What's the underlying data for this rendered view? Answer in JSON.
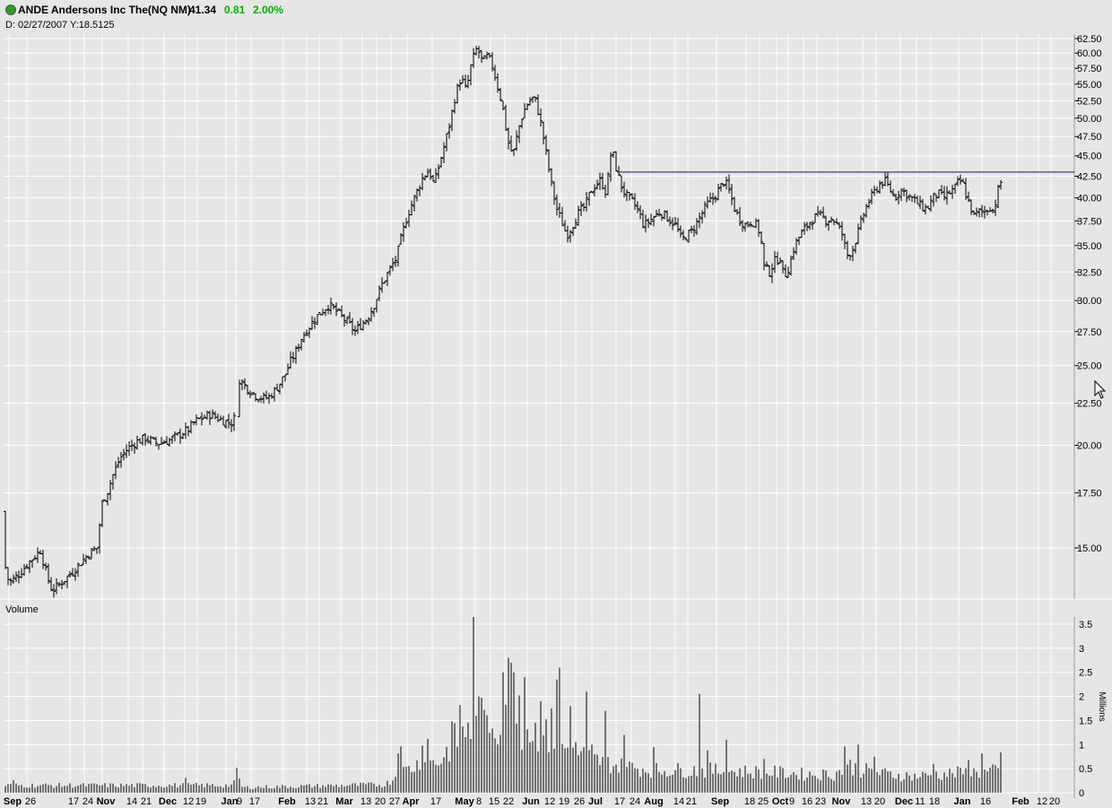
{
  "header": {
    "title": "ANDE Andersons Inc The(NQ NM)",
    "price": "41.34",
    "change": "0.81",
    "change_pct": "2.00%",
    "date_label": "D: 02/27/2007  Y:18.5125"
  },
  "colors": {
    "background": "#e6e6e6",
    "bars": "#000000",
    "resistance": "#5a2d9c",
    "gain": "#00b000"
  },
  "chart_data": [
    {
      "type": "ohlc",
      "title": "",
      "yscale": "log",
      "ylim": [
        13.5,
        63.5
      ],
      "yticks": [
        "62.50",
        "60.00",
        "57.50",
        "55.00",
        "52.50",
        "50.00",
        "47.50",
        "45.00",
        "42.50",
        "40.00",
        "37.50",
        "35.00",
        "32.50",
        "30.00",
        "27.50",
        "25.00",
        "22.50",
        "20.00",
        "17.50",
        "15.00"
      ],
      "xticks": [
        "Sep",
        "26",
        "17",
        "24",
        "Nov",
        "14",
        "21",
        "Dec",
        "12",
        "19",
        "Jan",
        "9",
        "17",
        "Feb",
        "13",
        "21",
        "Mar",
        "13",
        "20",
        "27",
        "Apr",
        "17",
        "May",
        "8",
        "15",
        "22",
        "Jun",
        "12",
        "19",
        "26",
        "Jul",
        "17",
        "24",
        "Aug",
        "14",
        "21",
        "Sep",
        "18",
        "25",
        "Oct",
        "9",
        "16",
        "23",
        "Nov",
        "13",
        "20",
        "Dec",
        "11",
        "18",
        "Jan",
        "16",
        "Feb",
        "12",
        "20"
      ],
      "resistance_level": 43.0,
      "price_path": [
        [
          0,
          16.6
        ],
        [
          4,
          14.5
        ],
        [
          10,
          13.6
        ],
        [
          20,
          13.9
        ],
        [
          32,
          14.4
        ],
        [
          45,
          14.9
        ],
        [
          52,
          13.9
        ],
        [
          58,
          13.3
        ],
        [
          68,
          13.6
        ],
        [
          80,
          14.0
        ],
        [
          90,
          14.4
        ],
        [
          100,
          14.8
        ],
        [
          108,
          15.0
        ],
        [
          114,
          17.0
        ],
        [
          120,
          17.6
        ],
        [
          126,
          18.4
        ],
        [
          134,
          19.3
        ],
        [
          142,
          19.8
        ],
        [
          152,
          20.2
        ],
        [
          162,
          20.4
        ],
        [
          175,
          20.1
        ],
        [
          190,
          20.3
        ],
        [
          200,
          20.6
        ],
        [
          210,
          20.9
        ],
        [
          218,
          21.4
        ],
        [
          226,
          21.6
        ],
        [
          234,
          21.8
        ],
        [
          242,
          21.6
        ],
        [
          250,
          21.4
        ],
        [
          258,
          21.3
        ],
        [
          262,
          21.6
        ],
        [
          265,
          24.2
        ],
        [
          275,
          23.5
        ],
        [
          285,
          23.0
        ],
        [
          293,
          22.8
        ],
        [
          300,
          22.9
        ],
        [
          306,
          23.3
        ],
        [
          312,
          23.8
        ],
        [
          318,
          24.4
        ],
        [
          324,
          25.3
        ],
        [
          330,
          26.0
        ],
        [
          336,
          27.0
        ],
        [
          344,
          27.8
        ],
        [
          352,
          28.6
        ],
        [
          360,
          29.2
        ],
        [
          366,
          29.6
        ],
        [
          374,
          29.2
        ],
        [
          382,
          28.6
        ],
        [
          390,
          28.0
        ],
        [
          396,
          27.5
        ],
        [
          402,
          28.0
        ],
        [
          410,
          28.6
        ],
        [
          418,
          29.8
        ],
        [
          426,
          31.4
        ],
        [
          434,
          32.6
        ],
        [
          442,
          33.8
        ],
        [
          448,
          36.0
        ],
        [
          454,
          38.0
        ],
        [
          460,
          39.5
        ],
        [
          466,
          41.0
        ],
        [
          472,
          42.5
        ],
        [
          478,
          43.2
        ],
        [
          484,
          41.5
        ],
        [
          490,
          44.0
        ],
        [
          496,
          46.5
        ],
        [
          502,
          49.5
        ],
        [
          508,
          53.5
        ],
        [
          514,
          56.0
        ],
        [
          520,
          54.0
        ],
        [
          526,
          58.5
        ],
        [
          532,
          61.0
        ],
        [
          538,
          58.5
        ],
        [
          544,
          59.5
        ],
        [
          550,
          57.5
        ],
        [
          556,
          54.0
        ],
        [
          560,
          52.0
        ],
        [
          566,
          47.0
        ],
        [
          572,
          45.0
        ],
        [
          578,
          48.5
        ],
        [
          584,
          51.0
        ],
        [
          590,
          52.5
        ],
        [
          596,
          53.0
        ],
        [
          602,
          50.0
        ],
        [
          608,
          46.0
        ],
        [
          614,
          42.0
        ],
        [
          620,
          39.0
        ],
        [
          626,
          37.5
        ],
        [
          632,
          36.0
        ],
        [
          638,
          37.0
        ],
        [
          646,
          38.5
        ],
        [
          652,
          39.0
        ],
        [
          658,
          40.5
        ],
        [
          664,
          41.5
        ],
        [
          670,
          42.0
        ],
        [
          676,
          40.5
        ],
        [
          682,
          46.0
        ],
        [
          688,
          43.0
        ],
        [
          694,
          41.0
        ],
        [
          700,
          40.0
        ],
        [
          706,
          39.5
        ],
        [
          712,
          38.5
        ],
        [
          718,
          37.0
        ],
        [
          724,
          37.5
        ],
        [
          730,
          38.0
        ],
        [
          736,
          38.5
        ],
        [
          742,
          38.0
        ],
        [
          748,
          37.5
        ],
        [
          754,
          37.0
        ],
        [
          760,
          35.5
        ],
        [
          766,
          36.0
        ],
        [
          772,
          36.5
        ],
        [
          778,
          37.5
        ],
        [
          784,
          38.5
        ],
        [
          790,
          39.5
        ],
        [
          796,
          40.0
        ],
        [
          802,
          41.0
        ],
        [
          808,
          42.0
        ],
        [
          814,
          40.5
        ],
        [
          820,
          38.5
        ],
        [
          826,
          37.5
        ],
        [
          832,
          37.0
        ],
        [
          838,
          37.5
        ],
        [
          844,
          37.0
        ],
        [
          848,
          36.0
        ],
        [
          852,
          33.0
        ],
        [
          858,
          32.5
        ],
        [
          864,
          33.5
        ],
        [
          870,
          33.8
        ],
        [
          874,
          32.0
        ],
        [
          880,
          33.0
        ],
        [
          886,
          35.0
        ],
        [
          892,
          36.0
        ],
        [
          898,
          36.8
        ],
        [
          904,
          37.5
        ],
        [
          910,
          38.0
        ],
        [
          916,
          38.0
        ],
        [
          922,
          37.5
        ],
        [
          928,
          37.8
        ],
        [
          934,
          37.0
        ],
        [
          940,
          36.0
        ],
        [
          944,
          34.0
        ],
        [
          950,
          34.5
        ],
        [
          956,
          36.0
        ],
        [
          962,
          38.0
        ],
        [
          968,
          39.5
        ],
        [
          974,
          40.5
        ],
        [
          980,
          41.5
        ],
        [
          986,
          42.0
        ],
        [
          992,
          41.0
        ],
        [
          998,
          40.0
        ],
        [
          1004,
          41.0
        ],
        [
          1010,
          40.5
        ],
        [
          1016,
          40.0
        ],
        [
          1022,
          39.5
        ],
        [
          1028,
          39.0
        ],
        [
          1034,
          38.8
        ],
        [
          1040,
          40.0
        ],
        [
          1046,
          40.5
        ],
        [
          1052,
          40.0
        ],
        [
          1058,
          40.5
        ],
        [
          1064,
          41.0
        ],
        [
          1070,
          42.0
        ],
        [
          1074,
          41.5
        ],
        [
          1078,
          40.0
        ],
        [
          1082,
          39.0
        ],
        [
          1086,
          38.0
        ],
        [
          1092,
          38.5
        ],
        [
          1098,
          38.5
        ],
        [
          1104,
          39.0
        ],
        [
          1108,
          38.5
        ],
        [
          1112,
          40.5
        ],
        [
          1116,
          41.8
        ]
      ]
    },
    {
      "type": "bar",
      "title": "Volume",
      "ylabel": "Millions",
      "ylim": [
        0,
        3.6
      ],
      "yticks": [
        "3.5",
        "3",
        "2.5",
        "2",
        "1.5",
        "1",
        "0.5",
        "0"
      ],
      "baseline_volume": [
        [
          0,
          0.18
        ],
        [
          260,
          0.18
        ],
        [
          266,
          0.45
        ],
        [
          270,
          0.13
        ],
        [
          430,
          0.2
        ],
        [
          444,
          0.45
        ],
        [
          466,
          0.7
        ],
        [
          490,
          0.75
        ],
        [
          506,
          1.25
        ],
        [
          516,
          1.4
        ],
        [
          528,
          1.6
        ],
        [
          540,
          1.8
        ],
        [
          552,
          1.8
        ],
        [
          560,
          1.6
        ],
        [
          570,
          1.9
        ],
        [
          580,
          1.6
        ],
        [
          596,
          1.5
        ],
        [
          606,
          1.4
        ],
        [
          616,
          1.25
        ],
        [
          630,
          1.1
        ],
        [
          650,
          0.95
        ],
        [
          660,
          0.8
        ],
        [
          676,
          0.75
        ],
        [
          690,
          0.65
        ],
        [
          706,
          0.62
        ],
        [
          730,
          0.55
        ],
        [
          760,
          0.55
        ],
        [
          790,
          0.55
        ],
        [
          820,
          0.52
        ],
        [
          860,
          0.5
        ],
        [
          900,
          0.45
        ],
        [
          930,
          0.45
        ],
        [
          948,
          0.65
        ],
        [
          962,
          0.55
        ],
        [
          990,
          0.45
        ],
        [
          1020,
          0.4
        ],
        [
          1050,
          0.45
        ],
        [
          1080,
          0.5
        ],
        [
          1100,
          0.5
        ],
        [
          1116,
          0.55
        ]
      ],
      "volume_spikes": [
        [
          14,
          0.26
        ],
        [
          207,
          0.31
        ],
        [
          265,
          0.52
        ],
        [
          444,
          0.82
        ],
        [
          448,
          0.96
        ],
        [
          472,
          0.98
        ],
        [
          478,
          1.12
        ],
        [
          504,
          1.48
        ],
        [
          514,
          1.82
        ],
        [
          522,
          1.46
        ],
        [
          529,
          3.65
        ],
        [
          534,
          2.0
        ],
        [
          541,
          1.72
        ],
        [
          557,
          1.2
        ],
        [
          562,
          2.5
        ],
        [
          566,
          2.8
        ],
        [
          569,
          2.7
        ],
        [
          574,
          2.5
        ],
        [
          580,
          2.02
        ],
        [
          586,
          2.4
        ],
        [
          602,
          1.9
        ],
        [
          614,
          1.75
        ],
        [
          620,
          2.35
        ],
        [
          625,
          2.6
        ],
        [
          636,
          1.8
        ],
        [
          654,
          2.1
        ],
        [
          660,
          1.0
        ],
        [
          676,
          1.7
        ],
        [
          696,
          1.2
        ],
        [
          730,
          0.95
        ],
        [
          781,
          2.05
        ],
        [
          790,
          0.88
        ],
        [
          810,
          1.1
        ],
        [
          852,
          0.7
        ],
        [
          942,
          0.96
        ],
        [
          958,
          1.0
        ],
        [
          974,
          0.75
        ],
        [
          1040,
          0.6
        ],
        [
          1080,
          0.68
        ],
        [
          1096,
          0.82
        ],
        [
          1116,
          0.84
        ]
      ]
    }
  ]
}
